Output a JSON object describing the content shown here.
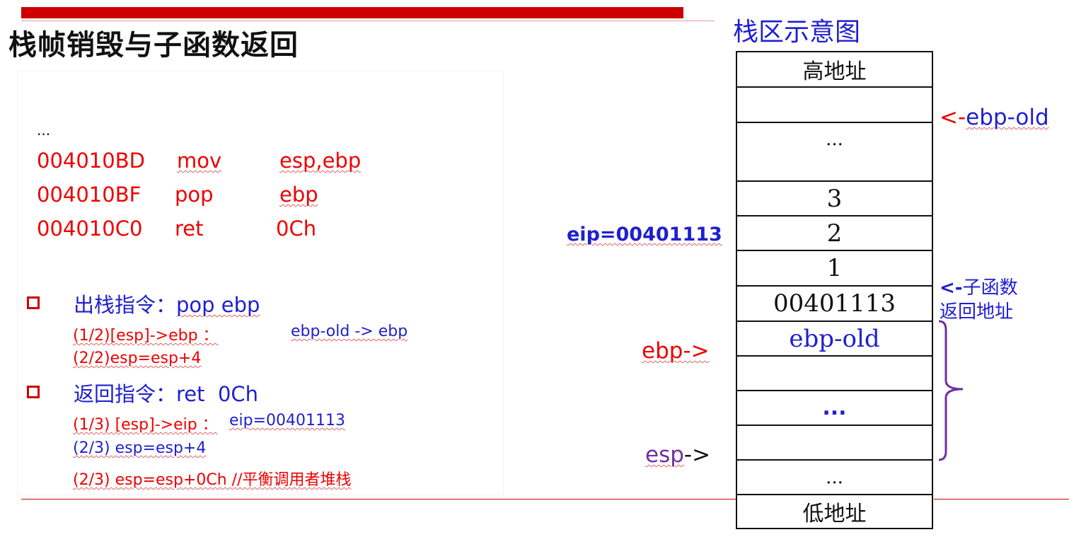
{
  "page_title": "栈帧销毁与子函数返回",
  "code": {
    "ellipsis": "...",
    "lines": [
      {
        "addr": "004010BD",
        "op": "mov",
        "arg": "esp,ebp"
      },
      {
        "addr": "004010BF",
        "op": "pop",
        "arg": "ebp"
      },
      {
        "addr": "004010C0",
        "op": "ret",
        "arg": "0Ch"
      }
    ]
  },
  "sections": [
    {
      "heading_prefix": "出栈指令：",
      "heading_code": "pop ebp",
      "steps": [
        {
          "left": "(1/2)[esp]->ebp ：",
          "right": "ebp-old -> ebp"
        },
        {
          "left": "(2/2)esp=esp+4",
          "right": ""
        }
      ]
    },
    {
      "heading_prefix": "返回指令：",
      "heading_code": "ret  0Ch",
      "steps": [
        {
          "left": "(1/3) [esp]->eip ：",
          "right": "eip=00401113"
        },
        {
          "left": "(2/3) esp=esp+4",
          "right": ""
        },
        {
          "left": "(2/3) esp=esp+0Ch //平衡调用者堆栈",
          "right": ""
        }
      ]
    }
  ],
  "diagram": {
    "title": "栈区示意图",
    "cells": [
      {
        "label": "高地址"
      },
      {
        "label": ""
      },
      {
        "label": "..."
      },
      {
        "label": "3"
      },
      {
        "label": "2"
      },
      {
        "label": "1"
      },
      {
        "label": "00401113"
      },
      {
        "label": "ebp-old"
      },
      {
        "label": ""
      },
      {
        "label": "..."
      },
      {
        "label": ""
      },
      {
        "label": "..."
      },
      {
        "label": "低地址"
      }
    ],
    "labels": {
      "ebp_old_arrow": "<-",
      "ebp_old_text": "ebp-old",
      "eip": "eip=00401113",
      "ret_arrow": "<-",
      "ret_line1": "子函数",
      "ret_line2": "返回地址",
      "ebp_pointer": "ebp->",
      "esp_word": "esp",
      "esp_arrow": "->"
    }
  },
  "colors": {
    "accent_red": "#cc0000",
    "code_red": "#ee0000",
    "blue": "#1f1fcf",
    "purple": "#7030a0"
  }
}
